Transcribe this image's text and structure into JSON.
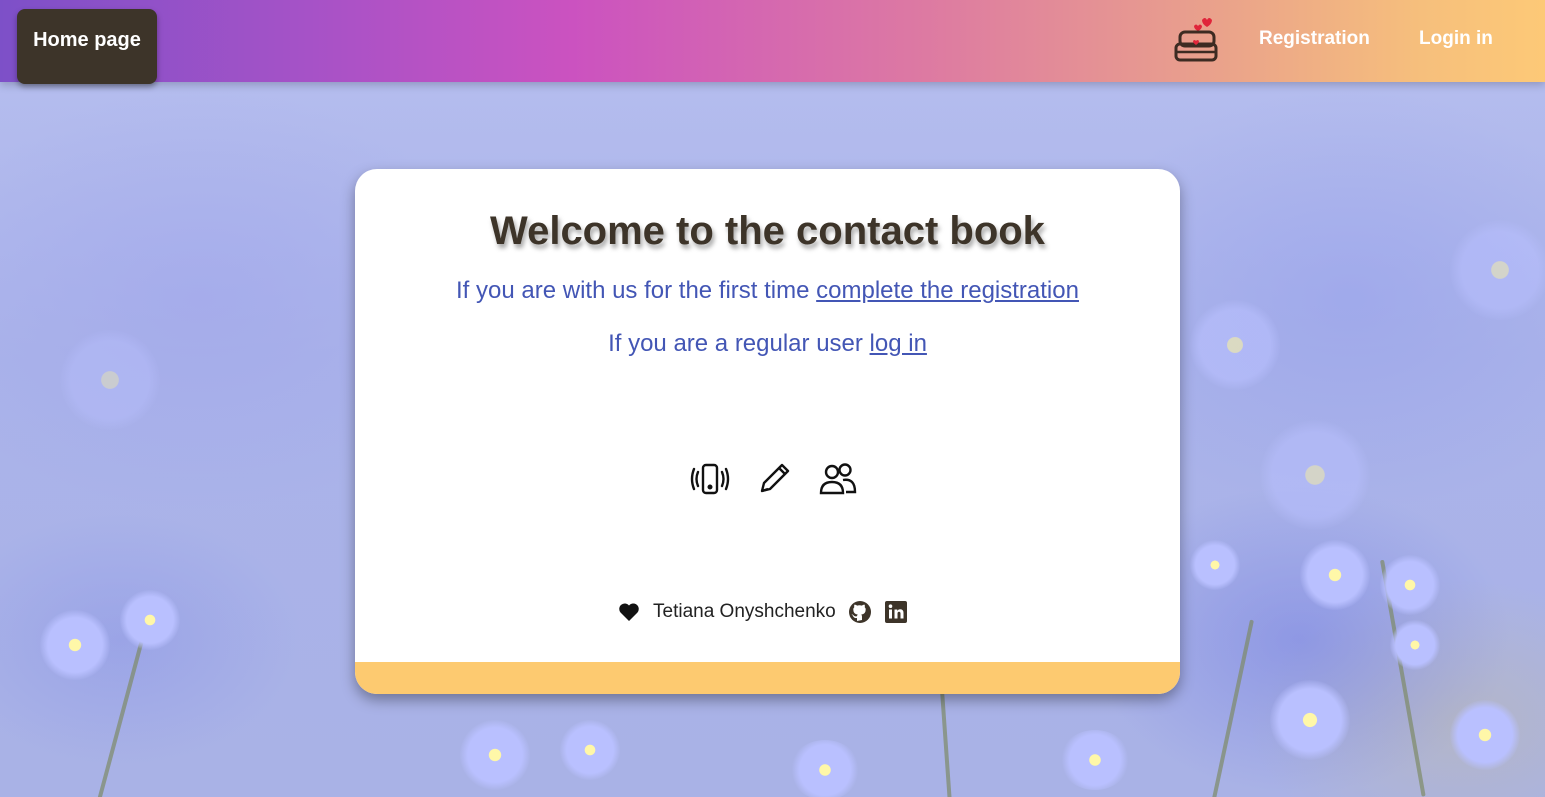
{
  "header": {
    "home_label": "Home page",
    "nav": {
      "registration": "Registration",
      "login": "Login in"
    },
    "logo_icon": "contact-book-heart-icon"
  },
  "card": {
    "title": "Welcome to the contact book",
    "first_time_text": "If you are with us for the first time ",
    "registration_link": "complete the registration",
    "regular_text": "If you are a regular user ",
    "login_link": "log in",
    "feature_icons": [
      "vibrating-phone-icon",
      "pencil-icon",
      "users-icon"
    ],
    "author": "Tetiana Onyshchenko",
    "footer_icons": [
      "heart-icon",
      "github-icon",
      "linkedin-icon"
    ]
  },
  "colors": {
    "accent_dark": "#3d3429",
    "link_blue": "#4356b5",
    "card_bar": "#fdca70",
    "header_gradient_start": "#7d50c8",
    "header_gradient_end": "#fdc977"
  }
}
